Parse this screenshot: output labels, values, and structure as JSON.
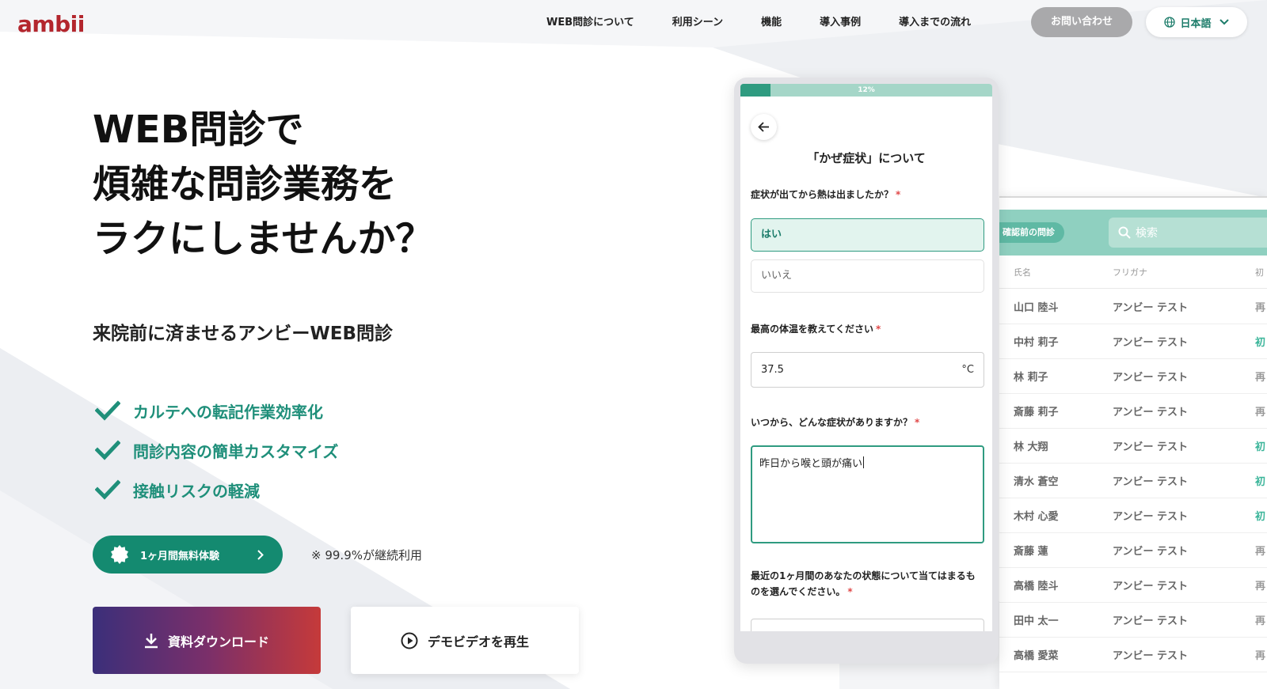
{
  "header": {
    "logo": "ambii",
    "nav": [
      "WEB問診について",
      "利用シーン",
      "機能",
      "導入事例",
      "導入までの流れ"
    ],
    "contact_label": "お問い合わせ",
    "lang_label": "日本語"
  },
  "hero": {
    "title_lines": [
      "WEB問診で",
      "煩雑な問診業務を",
      "ラクにしませんか？"
    ],
    "subtitle": "来院前に済ませるアンビーWEB問診",
    "features": [
      "カルテへの転記作業効率化",
      "問診内容の簡単カスタマイズ",
      "接触リスクの軽減"
    ],
    "trial_label": "1ヶ月間無料体験",
    "retention_note": "※ 99.9%が継続利用",
    "download_label": "資料ダウンロード",
    "demo_label": "デモビデオを再生"
  },
  "phone": {
    "progress_percent": 12,
    "progress_label": "12%",
    "form_title": "「かぜ症状」について",
    "q1": "症状が出てから熱は出ましたか？",
    "q1_options": [
      "はい",
      "いいえ"
    ],
    "q2": "最高の体温を教えてください",
    "q2_value": "37.5",
    "q2_unit": "°C",
    "q3": "いつから、どんな症状がありますか？",
    "q3_value": "昨日から喉と頭が痛い",
    "q4": "最近の1ヶ月間のあなたの状態について当てはまるものを選んでください。",
    "required_mark": "*"
  },
  "admin": {
    "pill": "確認前の問診",
    "search_placeholder": "検索",
    "columns": [
      "氏名",
      "フリガナ",
      "初"
    ],
    "rows": [
      {
        "name": "山口 陸斗",
        "kana": "アンビー テスト",
        "status": "再"
      },
      {
        "name": "中村 莉子",
        "kana": "アンビー テスト",
        "status": "初"
      },
      {
        "name": "林 莉子",
        "kana": "アンビー テスト",
        "status": "再"
      },
      {
        "name": "斎藤 莉子",
        "kana": "アンビー テスト",
        "status": "再"
      },
      {
        "name": "林 大翔",
        "kana": "アンビー テスト",
        "status": "初"
      },
      {
        "name": "清水 蒼空",
        "kana": "アンビー テスト",
        "status": "初"
      },
      {
        "name": "木村 心愛",
        "kana": "アンビー テスト",
        "status": "初"
      },
      {
        "name": "斎藤 蓮",
        "kana": "アンビー テスト",
        "status": "再"
      },
      {
        "name": "高橋 陸斗",
        "kana": "アンビー テスト",
        "status": "再"
      },
      {
        "name": "田中 太一",
        "kana": "アンビー テスト",
        "status": "再"
      },
      {
        "name": "高橋 愛菜",
        "kana": "アンビー テスト",
        "status": "再"
      }
    ]
  },
  "colors": {
    "brand_red": "#b3262d",
    "teal": "#148a70",
    "teal_light": "#8fd0c0"
  },
  "icons": [
    "globe-icon",
    "chevron-down-icon",
    "check-icon",
    "badge-icon",
    "chevron-right-icon",
    "download-icon",
    "play-icon",
    "arrow-left-icon",
    "search-icon"
  ]
}
